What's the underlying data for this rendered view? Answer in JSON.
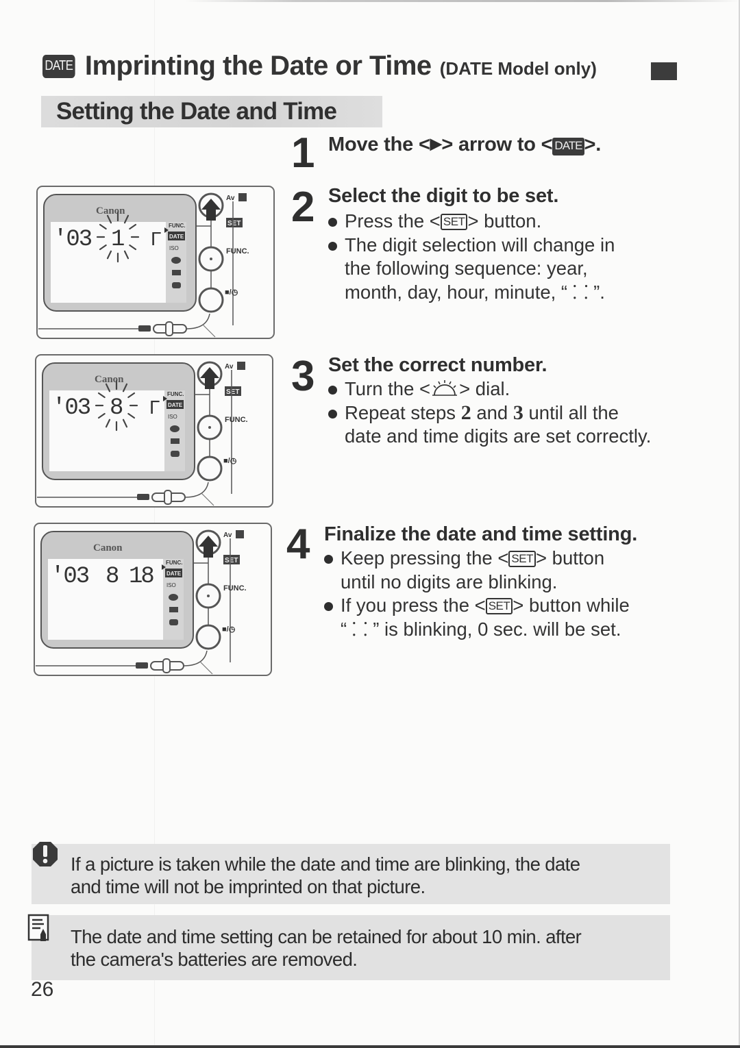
{
  "header": {
    "badge": "DATE",
    "title": "Imprinting the Date or Time",
    "suffix": "(DATE Model only)"
  },
  "section": {
    "title": "Setting the Date and Time"
  },
  "icons": {
    "set_label": "SET",
    "date_label": "DATE",
    "arrow": "▶",
    "dial": "main-dial-icon"
  },
  "steps": [
    {
      "number": "1",
      "title_pre": "Move the <",
      "title_mid": "> arrow to <",
      "title_post": ">."
    },
    {
      "number": "2",
      "title": "Select the digit to be set.",
      "bullets": [
        {
          "pre": "Press the <",
          "post": "> button."
        },
        {
          "lines": [
            "The digit selection will change in",
            "the following sequence: year,",
            "month, day, hour, minute, “ ⸬ ”."
          ]
        }
      ]
    },
    {
      "number": "3",
      "title": "Set the correct number.",
      "bullets": [
        {
          "pre": "Turn the <",
          "post": "> dial."
        },
        {
          "pre": "Repeat steps ",
          "step_a": "2",
          "mid": " and ",
          "step_b": "3",
          "post": " until all the",
          "line2": "date and time digits are set correctly."
        }
      ]
    },
    {
      "number": "4",
      "title": "Finalize the date and time setting.",
      "bullets": [
        {
          "pre": "Keep pressing the <",
          "post": "> button",
          "line2": "until no digits are blinking."
        },
        {
          "pre": "If you press the <",
          "post": "> button while",
          "line2": "“ ⸬ ” is blinking, 0 sec. will be set."
        }
      ]
    }
  ],
  "illustrations": [
    {
      "brand": "Canon",
      "year": "'03",
      "digit_month": "1",
      "digit_day": "",
      "digit_hour": "",
      "blinking": "month",
      "labels": {
        "av": "Av",
        "set": "SET",
        "func": "FUNC.",
        "drive": "■/◷",
        "mode": "FUNC.",
        "date": "DATE",
        "iso": "ISO"
      }
    },
    {
      "brand": "Canon",
      "year": "'03",
      "digit_month": "8",
      "digit_day": "",
      "digit_hour": "",
      "blinking": "month",
      "labels": {
        "av": "Av",
        "set": "SET",
        "func": "FUNC.",
        "drive": "■/◷",
        "mode": "FUNC.",
        "date": "DATE",
        "iso": "ISO"
      }
    },
    {
      "brand": "Canon",
      "year": "'03",
      "digit_month": "8",
      "digit_day": "18",
      "digit_hour": "",
      "blinking": "none",
      "labels": {
        "av": "Av",
        "set": "SET",
        "func": "FUNC.",
        "drive": "■/◷",
        "mode": "FUNC.",
        "date": "DATE",
        "iso": "ISO"
      }
    }
  ],
  "caution": {
    "icon": "caution-icon",
    "line1": "If a picture is taken while the date and time are blinking, the date",
    "line2": "and time will not be imprinted on that picture."
  },
  "memo": {
    "icon": "memo-icon",
    "line1": "The date and time setting can be retained for about 10 min. after",
    "line2": "the camera's batteries are removed."
  },
  "footer": {
    "page_number": "26"
  }
}
